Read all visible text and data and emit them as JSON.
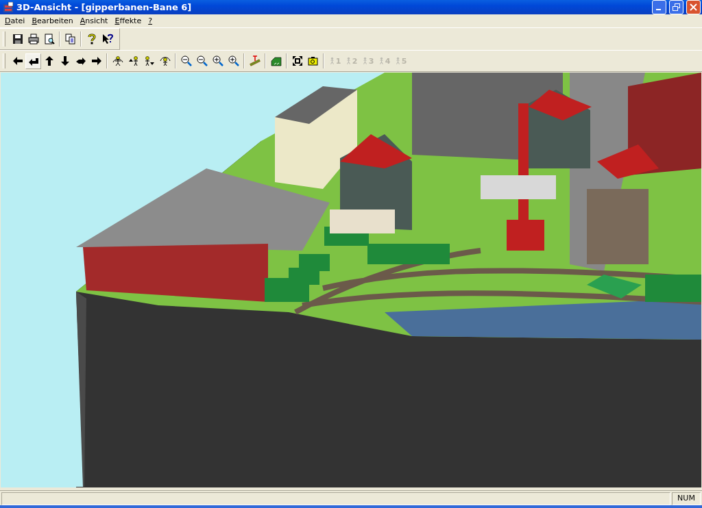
{
  "window": {
    "title": "3D-Ansicht - [gipperbanen-Bane 6]"
  },
  "menu": [
    {
      "label": "Datei",
      "mnemonic": true
    },
    {
      "label": "Bearbeiten",
      "mnemonic": true
    },
    {
      "label": "Ansicht",
      "mnemonic": true
    },
    {
      "label": "Effekte",
      "mnemonic": true
    },
    {
      "label": "?",
      "mnemonic": true
    }
  ],
  "toolbars": [
    [
      [
        {
          "kind": "save",
          "pressed": false
        },
        {
          "kind": "print",
          "pressed": false
        },
        {
          "kind": "preview",
          "pressed": false
        }
      ],
      [
        {
          "kind": "copy",
          "pressed": false
        }
      ],
      [
        {
          "kind": "help",
          "pressed": false
        },
        {
          "kind": "context-help",
          "pressed": false
        }
      ]
    ],
    [
      [
        {
          "kind": "left",
          "pressed": false
        },
        {
          "kind": "turn-left",
          "pressed": true
        },
        {
          "kind": "up",
          "pressed": false
        },
        {
          "kind": "down",
          "pressed": false
        },
        {
          "kind": "turn-right",
          "pressed": false
        },
        {
          "kind": "right",
          "pressed": false
        }
      ],
      [
        {
          "kind": "figure-orbit",
          "pressed": false
        },
        {
          "kind": "figure-up",
          "pressed": false
        },
        {
          "kind": "figure-down",
          "pressed": false
        },
        {
          "kind": "figure-arc",
          "pressed": false
        }
      ],
      [
        {
          "kind": "zoom-out-2",
          "pressed": false
        },
        {
          "kind": "zoom-out",
          "pressed": false
        },
        {
          "kind": "zoom-in",
          "pressed": false
        },
        {
          "kind": "zoom-in-2",
          "pressed": false
        }
      ],
      [
        {
          "kind": "track-height",
          "pressed": false
        }
      ],
      [
        {
          "kind": "terrain",
          "pressed": false
        }
      ],
      [
        {
          "kind": "fit",
          "pressed": false
        },
        {
          "kind": "camera",
          "pressed": false
        }
      ],
      [
        {
          "kind": "slot",
          "label": "1",
          "disabled": true
        },
        {
          "kind": "slot",
          "label": "2",
          "disabled": true
        },
        {
          "kind": "slot",
          "label": "3",
          "disabled": true
        },
        {
          "kind": "slot",
          "label": "4",
          "disabled": true
        },
        {
          "kind": "slot",
          "label": "5",
          "disabled": true
        }
      ]
    ]
  ],
  "status_bar": {
    "panels": [
      "NUM"
    ]
  }
}
